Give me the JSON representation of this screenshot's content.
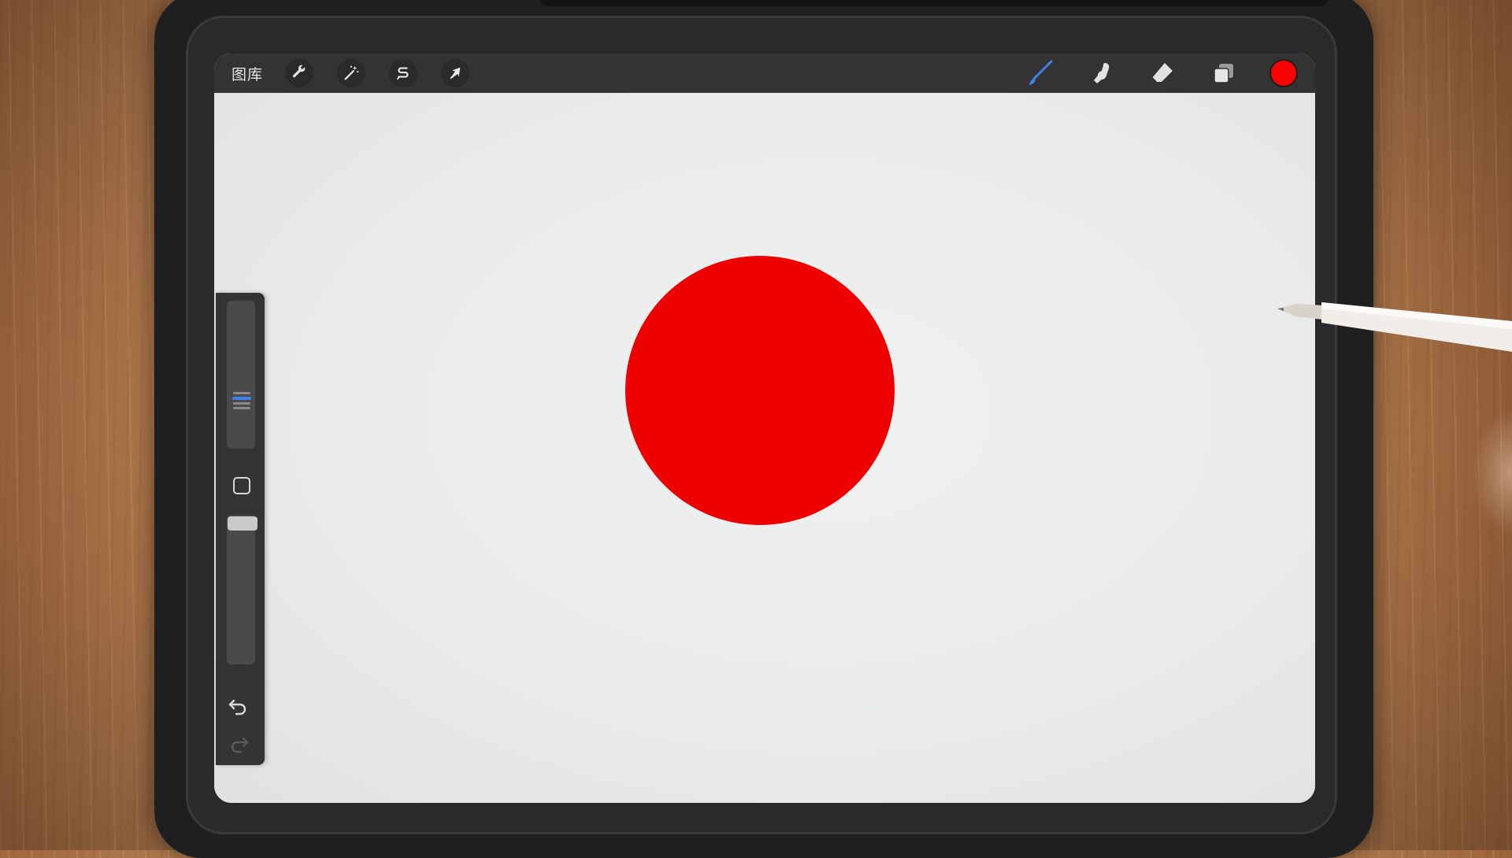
{
  "toolbar": {
    "gallery_label": "图库",
    "left_tools": [
      {
        "name": "actions",
        "icon": "wrench-icon"
      },
      {
        "name": "adjustments",
        "icon": "magic-wand-icon"
      },
      {
        "name": "selection",
        "icon": "selection-s-icon"
      },
      {
        "name": "transform",
        "icon": "arrow-cursor-icon"
      }
    ],
    "right_tools": [
      {
        "name": "brush",
        "icon": "paintbrush-icon",
        "active": true
      },
      {
        "name": "smudge",
        "icon": "smudge-finger-icon"
      },
      {
        "name": "eraser",
        "icon": "eraser-icon"
      },
      {
        "name": "layers",
        "icon": "layers-icon"
      }
    ],
    "current_color": "#ff0000"
  },
  "canvas": {
    "background": "#e9eaea",
    "shape": {
      "type": "circle",
      "fill": "#ee0000"
    }
  },
  "sidebar": {
    "brush_size_icon": "size-lines-icon",
    "modify_icon": "square-icon",
    "opacity_icon": "opacity-slider-icon",
    "undo_icon": "undo-arrow-icon",
    "redo_icon": "redo-arrow-icon"
  },
  "accent_color": "#3f82e8"
}
